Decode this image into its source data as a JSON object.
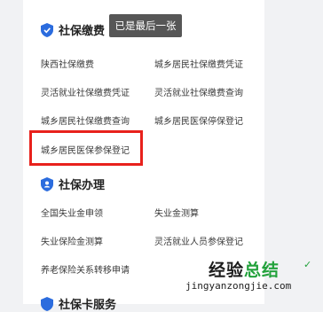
{
  "toast": {
    "text": "已是最后一张"
  },
  "sections": [
    {
      "title": "社保缴费",
      "icon": "shield-check-icon",
      "items": [
        "陕西社保缴费",
        "城乡居民社保缴费凭证",
        "灵活就业社保缴费凭证",
        "灵活就业社保缴费查询",
        "城乡居民社保缴费查询",
        "城乡居民医保停保登记",
        "城乡居民医保参保登记"
      ]
    },
    {
      "title": "社保办理",
      "icon": "shield-user-icon",
      "items": [
        "全国失业金申领",
        "失业金测算",
        "失业保险金测算",
        "灵活就业人员参保登记",
        "养老保险关系转移申请"
      ]
    },
    {
      "title": "社保卡服务",
      "icon": "shield-card-icon"
    }
  ],
  "watermark": {
    "cn_part1": "经验",
    "cn_part2": "总结",
    "url": "jingyanzongjie.com",
    "check": "✓"
  },
  "colors": {
    "accent": "#2b6cde",
    "highlight": "#e8211c",
    "toast_bg": "#565656",
    "watermark_green": "#23a23c"
  }
}
